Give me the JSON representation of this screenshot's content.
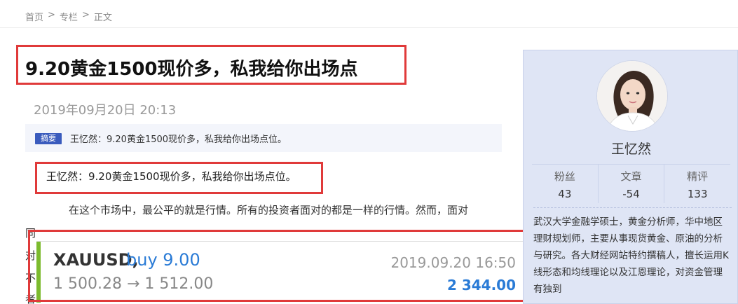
{
  "breadcrumb": [
    "首页",
    "专栏",
    "正文"
  ],
  "breadcrumb_sep": ">",
  "article": {
    "title": "9.20黄金1500现价多，私我给你出场点",
    "date": "2019年09月20日  20:13",
    "summary_tag": "摘要",
    "summary_text": "王忆然：9.20黄金1500现价多，私我给你出场点位。",
    "quote": "王忆然：9.20黄金1500现价多，私我给你出场点位。",
    "paragraph": "在这个市场中，最公平的就是行情。所有的投资者面对的都是一样的行情。然而，面对",
    "side_chars": [
      "同",
      "对",
      "不",
      "者"
    ]
  },
  "trade": {
    "symbol": "XAUUSD,",
    "action": "buy 9.00",
    "prices": "1 500.28 → 1 512.00",
    "time": "2019.09.20 16:50",
    "profit": "2 344.00",
    "accent_color": "#7cbb2e",
    "action_color": "#2a7bd6"
  },
  "author": {
    "name": "王忆然",
    "avatar_icon": "avatar-photo-icon",
    "stats": [
      {
        "label": "粉丝",
        "value": "43"
      },
      {
        "label": "文章",
        "value": "-54"
      },
      {
        "label": "精评",
        "value": "133"
      }
    ],
    "bio": "武汉大学金融学硕士，黄金分析师，华中地区理财规划师，主要从事现货黄金、原油的分析与研究。各大财经网站特约撰稿人，擅长运用K线形态和均线理论以及江恩理论，对资金管理有独到"
  },
  "colors": {
    "highlight_border": "#e03a3a",
    "sidebar_bg": "#dfe5f5",
    "tag_bg": "#3a5bbd"
  }
}
